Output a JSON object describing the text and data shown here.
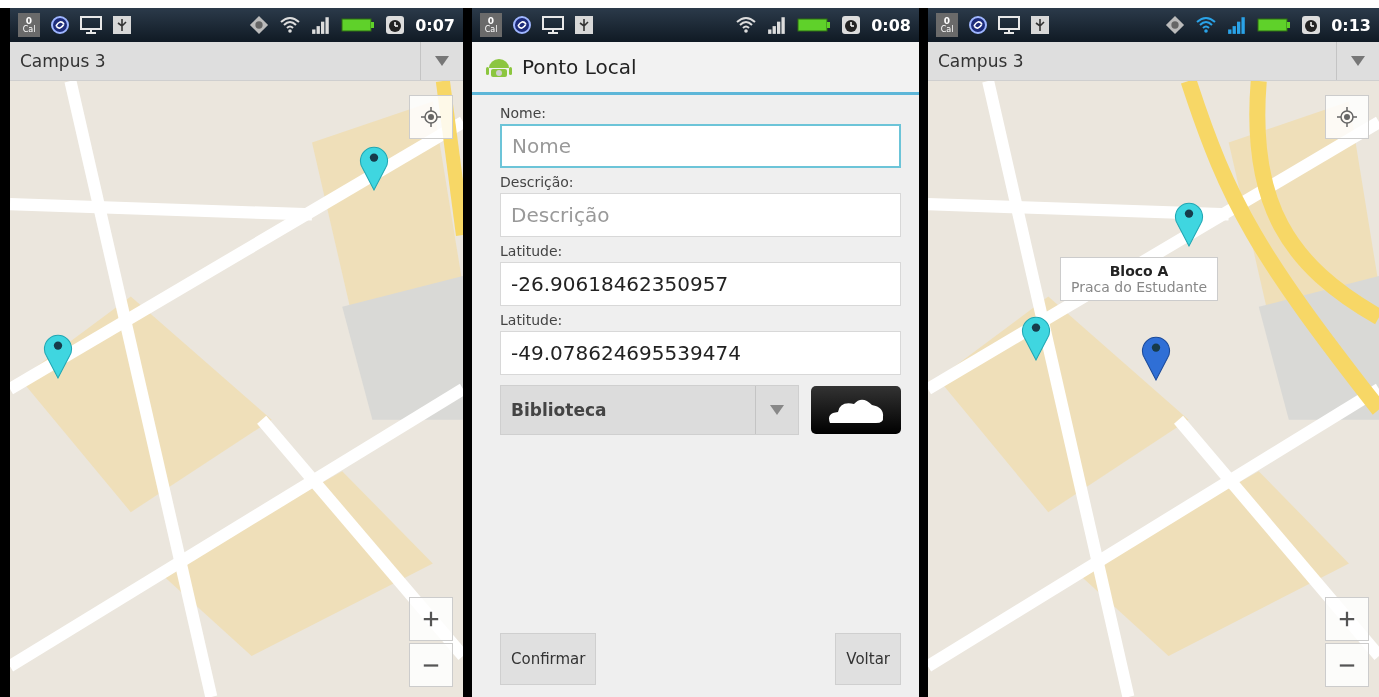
{
  "screens": [
    {
      "kind": "map",
      "status_bar": {
        "cal_count": "0",
        "cal_label": "Cal",
        "gps": true,
        "wifi_active": false,
        "time": "0:07"
      },
      "location_spinner": {
        "value": "Campus 3"
      },
      "pins": [
        {
          "selected": false
        },
        {
          "selected": false
        }
      ]
    },
    {
      "kind": "form",
      "status_bar": {
        "cal_count": "0",
        "cal_label": "Cal",
        "gps": false,
        "wifi_active": false,
        "time": "0:08"
      },
      "title": "Ponto Local",
      "fields": [
        {
          "label": "Nome:",
          "placeholder": "Nome",
          "focused": true
        },
        {
          "label": "Descrição:",
          "placeholder": "Descrição",
          "focused": false
        },
        {
          "label": "Latitude:",
          "value": "-26.90618462350957",
          "focused": false
        },
        {
          "label": "Latitude:",
          "value": "-49.078624695539474",
          "focused": false
        }
      ],
      "category_spinner": {
        "value": "Biblioteca"
      },
      "buttons": [
        "Confirmar",
        "Voltar"
      ]
    },
    {
      "kind": "map",
      "status_bar": {
        "cal_count": "0",
        "cal_label": "Cal",
        "gps": true,
        "wifi_active": true,
        "time": "0:13"
      },
      "location_spinner": {
        "value": "Campus 3"
      },
      "pins": [
        {
          "selected": false
        },
        {
          "selected": false
        },
        {
          "selected": true
        }
      ],
      "info_window": {
        "title": "Bloco A",
        "subtitle": "Praca do Estudante"
      }
    }
  ]
}
